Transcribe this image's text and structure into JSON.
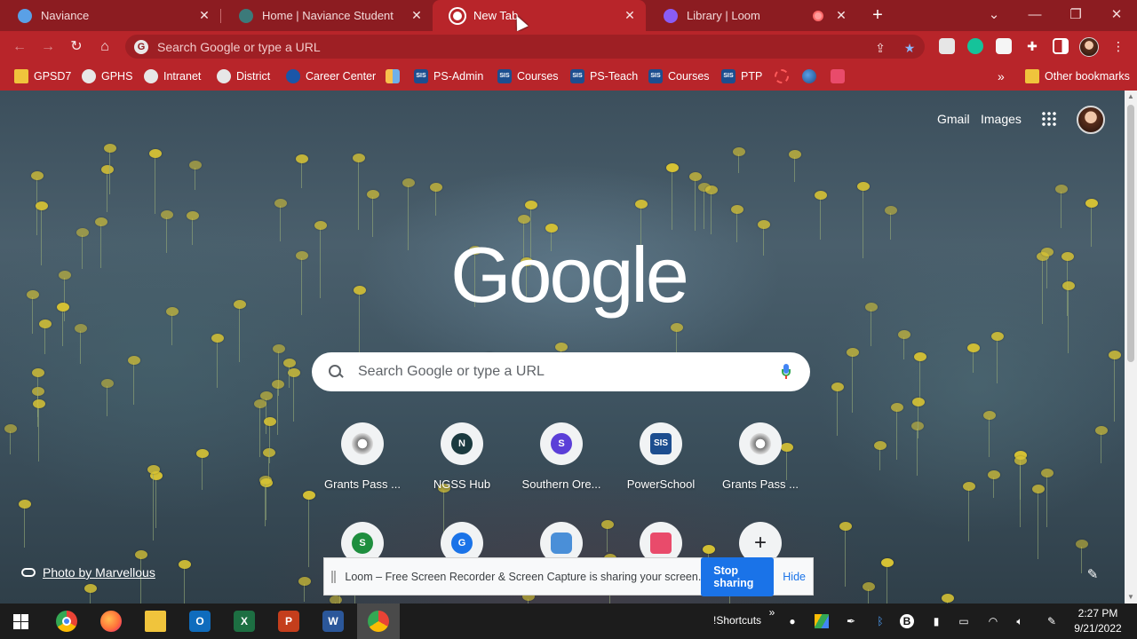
{
  "tabs": [
    {
      "title": "Naviance",
      "favicon_color": "#5aa0e6",
      "active": false
    },
    {
      "title": "Home | Naviance Student",
      "favicon_color": "#3c7a7a",
      "active": false
    },
    {
      "title": "New Tab",
      "favicon_color": "#ffffff",
      "active": true
    },
    {
      "title": "Library | Loom",
      "favicon_color": "#8a5cf6",
      "active": false
    }
  ],
  "close_glyph": "✕",
  "newtab_glyph": "+",
  "window_controls": {
    "dropdown": "⌄",
    "minimize": "—",
    "restore": "❐",
    "close": "✕"
  },
  "toolbar": {
    "back": "←",
    "forward": "→",
    "reload": "↻",
    "home": "⌂",
    "omnibox_placeholder": "Search Google or type a URL",
    "share_icon": "⇪",
    "star_icon": "★"
  },
  "bookmarks": [
    {
      "label": "GPSD7",
      "icon": "folder"
    },
    {
      "label": "GPHS",
      "icon": "round"
    },
    {
      "label": "Intranet",
      "icon": "round"
    },
    {
      "label": "District",
      "icon": "round"
    },
    {
      "label": "Career Center",
      "icon": "blue"
    },
    {
      "label": "",
      "icon": "multi"
    },
    {
      "label": "PS-Admin",
      "icon": "sis"
    },
    {
      "label": "Courses",
      "icon": "sis"
    },
    {
      "label": "PS-Teach",
      "icon": "sis"
    },
    {
      "label": "Courses",
      "icon": "sis"
    },
    {
      "label": "PTP",
      "icon": "sis"
    },
    {
      "label": "",
      "icon": "redring"
    },
    {
      "label": "",
      "icon": "bluedisk"
    },
    {
      "label": "",
      "icon": "pink"
    }
  ],
  "bookmarks_overflow": "»",
  "other_bookmarks": "Other bookmarks",
  "sis_text": "SIS",
  "ntp": {
    "gmail": "Gmail",
    "images": "Images",
    "logo": "Google",
    "search_placeholder": "Search Google or type a URL",
    "shortcuts": [
      {
        "label": "Grants Pass ...",
        "letter": "",
        "color": "#e8e8e8"
      },
      {
        "label": "NGSS Hub",
        "letter": "N",
        "color": "#1b3a3f"
      },
      {
        "label": "Southern Ore...",
        "letter": "S",
        "color": "#5b3fd8"
      },
      {
        "label": "PowerSchool",
        "letter": "SIS",
        "color": "#1d4e8f"
      },
      {
        "label": "Grants Pass ...",
        "letter": "",
        "color": "#e8e8e8"
      }
    ],
    "shortcuts_row2": [
      {
        "letter": "S",
        "color": "#1e8e3e"
      },
      {
        "letter": "G",
        "color": "#1a73e8"
      },
      {
        "letter": "",
        "color": "#4a8fd8"
      },
      {
        "letter": "",
        "color": "#e94b6b"
      },
      {
        "letter": "+",
        "color": "#f1f3f4"
      }
    ],
    "photo_credit": "Photo by Marvellous",
    "pencil": "✎"
  },
  "loom": {
    "message": "Loom – Free Screen Recorder & Screen Capture is sharing your screen.",
    "stop": "Stop sharing",
    "hide": "Hide"
  },
  "taskbar": {
    "apps": [
      {
        "name": "chrome",
        "color": "#4285f4"
      },
      {
        "name": "firefox",
        "color": "#ff7139"
      },
      {
        "name": "file-explorer",
        "color": "#f0c43c"
      },
      {
        "name": "outlook",
        "color": "#0f6cbd"
      },
      {
        "name": "excel",
        "color": "#1d6f42"
      },
      {
        "name": "powerpoint",
        "color": "#c43e1c"
      },
      {
        "name": "word",
        "color": "#2b579a"
      }
    ],
    "shortcuts_label": "!Shortcuts",
    "tray_overflow": "»",
    "time": "2:27 PM",
    "date": "9/21/2022"
  }
}
